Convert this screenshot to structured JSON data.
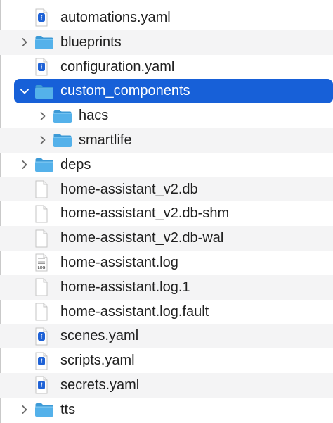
{
  "colors": {
    "selection": "#1760d8",
    "alt_row": "#f4f4f5",
    "folder": "#54b1ea",
    "folder_dark": "#3d9ad6",
    "yaml_badge": "#1f62d6",
    "text": "#1f1f1f"
  },
  "file_list": {
    "items": [
      {
        "label": "automations.yaml",
        "icon": "yaml-file-icon",
        "depth": 0,
        "expandable": false,
        "expanded": false,
        "selected": false
      },
      {
        "label": "blueprints",
        "icon": "folder-icon",
        "depth": 0,
        "expandable": true,
        "expanded": false,
        "selected": false
      },
      {
        "label": "configuration.yaml",
        "icon": "yaml-file-icon",
        "depth": 0,
        "expandable": false,
        "expanded": false,
        "selected": false
      },
      {
        "label": "custom_components",
        "icon": "folder-icon",
        "depth": 0,
        "expandable": true,
        "expanded": true,
        "selected": true
      },
      {
        "label": "hacs",
        "icon": "folder-icon",
        "depth": 1,
        "expandable": true,
        "expanded": false,
        "selected": false
      },
      {
        "label": "smartlife",
        "icon": "folder-icon",
        "depth": 1,
        "expandable": true,
        "expanded": false,
        "selected": false
      },
      {
        "label": "deps",
        "icon": "folder-icon",
        "depth": 0,
        "expandable": true,
        "expanded": false,
        "selected": false
      },
      {
        "label": "home-assistant_v2.db",
        "icon": "blank-file-icon",
        "depth": 0,
        "expandable": false,
        "expanded": false,
        "selected": false
      },
      {
        "label": "home-assistant_v2.db-shm",
        "icon": "blank-file-icon",
        "depth": 0,
        "expandable": false,
        "expanded": false,
        "selected": false
      },
      {
        "label": "home-assistant_v2.db-wal",
        "icon": "blank-file-icon",
        "depth": 0,
        "expandable": false,
        "expanded": false,
        "selected": false
      },
      {
        "label": "home-assistant.log",
        "icon": "log-file-icon",
        "badge": "LOG",
        "depth": 0,
        "expandable": false,
        "expanded": false,
        "selected": false
      },
      {
        "label": "home-assistant.log.1",
        "icon": "blank-file-icon",
        "depth": 0,
        "expandable": false,
        "expanded": false,
        "selected": false
      },
      {
        "label": "home-assistant.log.fault",
        "icon": "blank-file-icon",
        "depth": 0,
        "expandable": false,
        "expanded": false,
        "selected": false
      },
      {
        "label": "scenes.yaml",
        "icon": "yaml-file-icon",
        "depth": 0,
        "expandable": false,
        "expanded": false,
        "selected": false
      },
      {
        "label": "scripts.yaml",
        "icon": "yaml-file-icon",
        "depth": 0,
        "expandable": false,
        "expanded": false,
        "selected": false
      },
      {
        "label": "secrets.yaml",
        "icon": "yaml-file-icon",
        "depth": 0,
        "expandable": false,
        "expanded": false,
        "selected": false
      },
      {
        "label": "tts",
        "icon": "folder-icon",
        "depth": 0,
        "expandable": true,
        "expanded": false,
        "selected": false
      }
    ]
  }
}
